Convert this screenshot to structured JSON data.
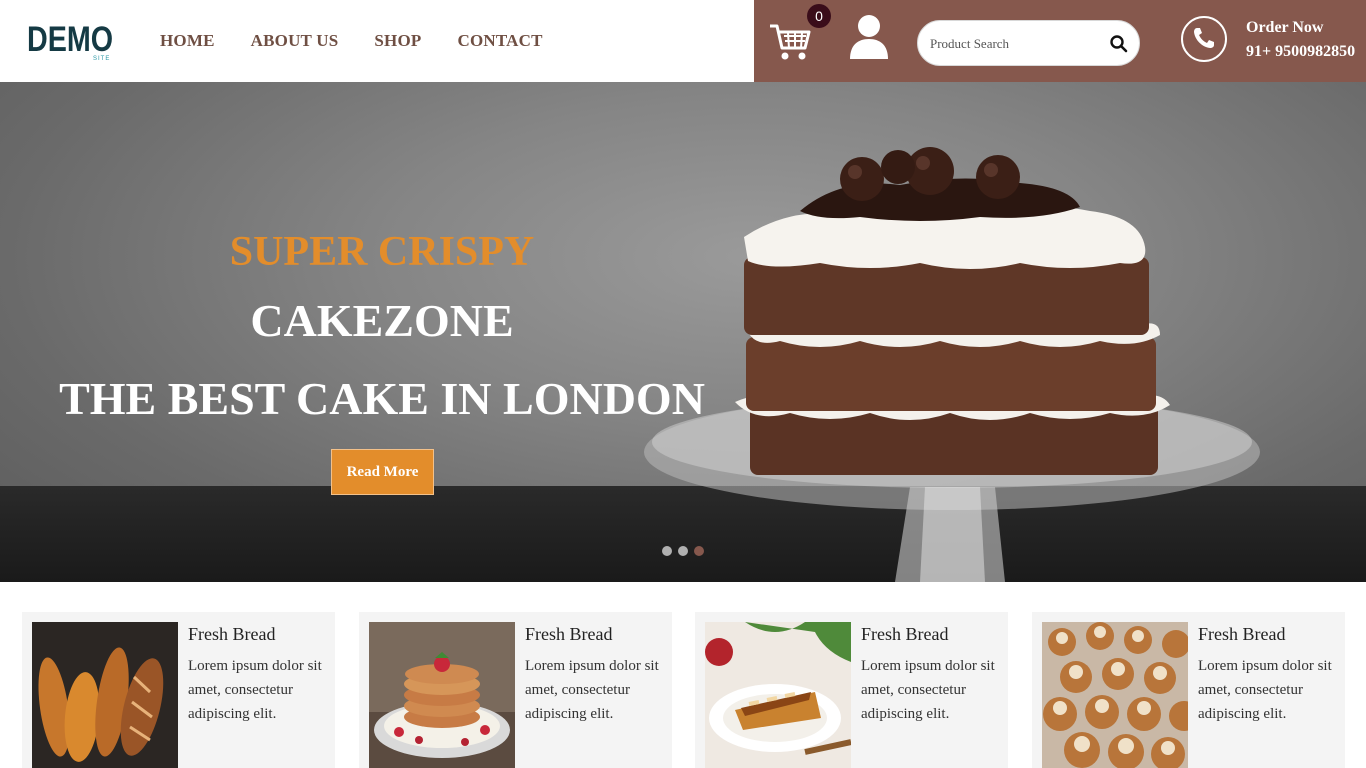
{
  "header": {
    "logo_text": "DEMO",
    "logo_sub": "SITE",
    "nav": [
      "HOME",
      "ABOUT US",
      "SHOP",
      "CONTACT"
    ],
    "cart_count": "0",
    "search_placeholder": "Product Search",
    "order_title": "Order Now",
    "order_phone": "91+ 9500982850"
  },
  "hero": {
    "kicker": "SUPER CRISPY",
    "brand": "CAKEZONE",
    "tagline": "THE BEST CAKE IN LONDON",
    "button_label": "Read More",
    "slide_count": 3,
    "active_slide": 3
  },
  "cards": [
    {
      "title": "Fresh Bread",
      "description": "Lorem ipsum dolor sit amet, consectetur adipiscing elit.",
      "image": "bread-loaves"
    },
    {
      "title": "Fresh Bread",
      "description": "Lorem ipsum dolor sit amet, consectetur adipiscing elit.",
      "image": "pancakes-berries"
    },
    {
      "title": "Fresh Bread",
      "description": "Lorem ipsum dolor sit amet, consectetur adipiscing elit.",
      "image": "pie-slice"
    },
    {
      "title": "Fresh Bread",
      "description": "Lorem ipsum dolor sit amet, consectetur adipiscing elit.",
      "image": "cupcakes"
    }
  ],
  "colors": {
    "brown": "#86584d",
    "orange": "#e38d2b",
    "nav_text": "#6f4f43",
    "logo": "#153a44"
  }
}
